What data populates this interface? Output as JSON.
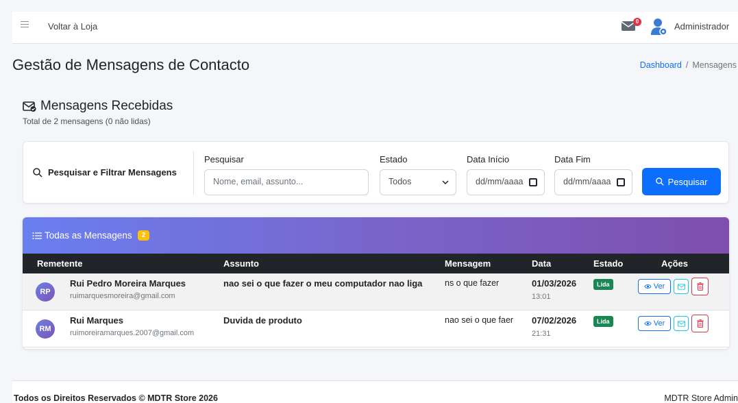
{
  "navbar": {
    "menu_icon": "hamburger-icon",
    "back_link": "Voltar à Loja",
    "mail_badge": "0",
    "user_name": "Administrador"
  },
  "page": {
    "title": "Gestão de Mensagens de Contacto",
    "breadcrumb": {
      "home": "Dashboard",
      "separator": "/",
      "current": "Mensagens"
    }
  },
  "section": {
    "title": "Mensagens Recebidas",
    "subtitle": "Total de 2 mensagens (0 não lidas)"
  },
  "filters": {
    "title": "Pesquisar e Filtrar Mensagens",
    "search_label": "Pesquisar",
    "search_placeholder": "Nome, email, assunto...",
    "status_label": "Estado",
    "status_value": "Todos",
    "start_label": "Data Início",
    "start_placeholder": "dd/mm/aaaa",
    "end_label": "Data Fim",
    "end_placeholder": "dd/mm/aaaa",
    "search_button": "Pesquisar"
  },
  "messages": {
    "title": "Todas as Mensagens",
    "count": "2",
    "columns": [
      "Remetente",
      "Assunto",
      "Mensagem",
      "Data",
      "Estado",
      "Ações"
    ],
    "rows": [
      {
        "initials": "RP",
        "name": "Rui Pedro Moreira Marques",
        "email": "ruimarquesmoreira@gmail.com",
        "subject": "nao sei o que fazer o meu computador nao liga",
        "message": "ns o que fazer",
        "date": "01/03/2026",
        "time": "13:01",
        "status": "Lida",
        "view_label": "Ver"
      },
      {
        "initials": "RM",
        "name": "Rui Marques",
        "email": "ruimoreiramarques.2007@gmail.com",
        "subject": "Duvida de produto",
        "message": "nao sei o que faer",
        "date": "07/02/2026",
        "time": "21:31",
        "status": "Lida",
        "view_label": "Ver"
      }
    ]
  },
  "footer": {
    "copyright": "Todos os Direitos Reservados © MDTR Store 2026",
    "right": "MDTR Store Admin"
  },
  "colors": {
    "primary": "#0d6efd",
    "success": "#198754",
    "danger": "#dc3545",
    "warning": "#ffc107",
    "dark": "#212529",
    "gradient_start": "#6a7ff0",
    "gradient_end": "#7e4fae"
  }
}
